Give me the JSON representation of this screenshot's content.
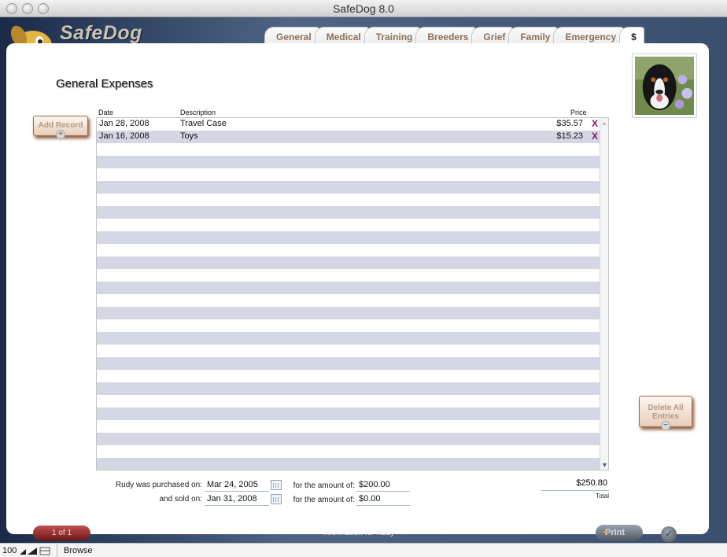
{
  "window": {
    "title": "SafeDog 8.0"
  },
  "app": {
    "brand": "SafeDog"
  },
  "tabs": [
    {
      "label": "General"
    },
    {
      "label": "Medical"
    },
    {
      "label": "Training"
    },
    {
      "label": "Breeders"
    },
    {
      "label": "Grief"
    },
    {
      "label": "Family"
    },
    {
      "label": "Emergency"
    },
    {
      "label": "$"
    }
  ],
  "page": {
    "title": "General Expenses"
  },
  "buttons": {
    "add_record": "Add Record",
    "delete_all": "Delete All Entries",
    "print": "Print"
  },
  "table": {
    "columns": {
      "date": "Date",
      "description": "Description",
      "price": "Price"
    },
    "rows": [
      {
        "date": "Jan 28, 2008",
        "description": "Travel Case",
        "price": "$35.57",
        "remove": "X"
      },
      {
        "date": "Jan 16, 2008",
        "description": "Toys",
        "price": "$15.23",
        "remove": "X"
      }
    ]
  },
  "purchase": {
    "purchased_label": "Rudy was purchased on:",
    "purchased_date": "Mar 24, 2005",
    "purchased_amount_label": "for the amount of:",
    "purchased_amount": "$200.00",
    "sold_label": "and sold on:",
    "sold_date": "Jan 31, 2008",
    "sold_amount_label": "for the amount of:",
    "sold_amount": "$0.00"
  },
  "total": {
    "value": "$250.80",
    "label": "Total"
  },
  "footer": {
    "record_counter": "1 of 1",
    "info": "Information for Rudy"
  },
  "statusbar": {
    "zoom": "100",
    "mode": "Browse"
  },
  "colors": {
    "accent": "#8b1a5a",
    "row_alt": "#d4d6e4",
    "header_bg": "#1a2b48"
  }
}
